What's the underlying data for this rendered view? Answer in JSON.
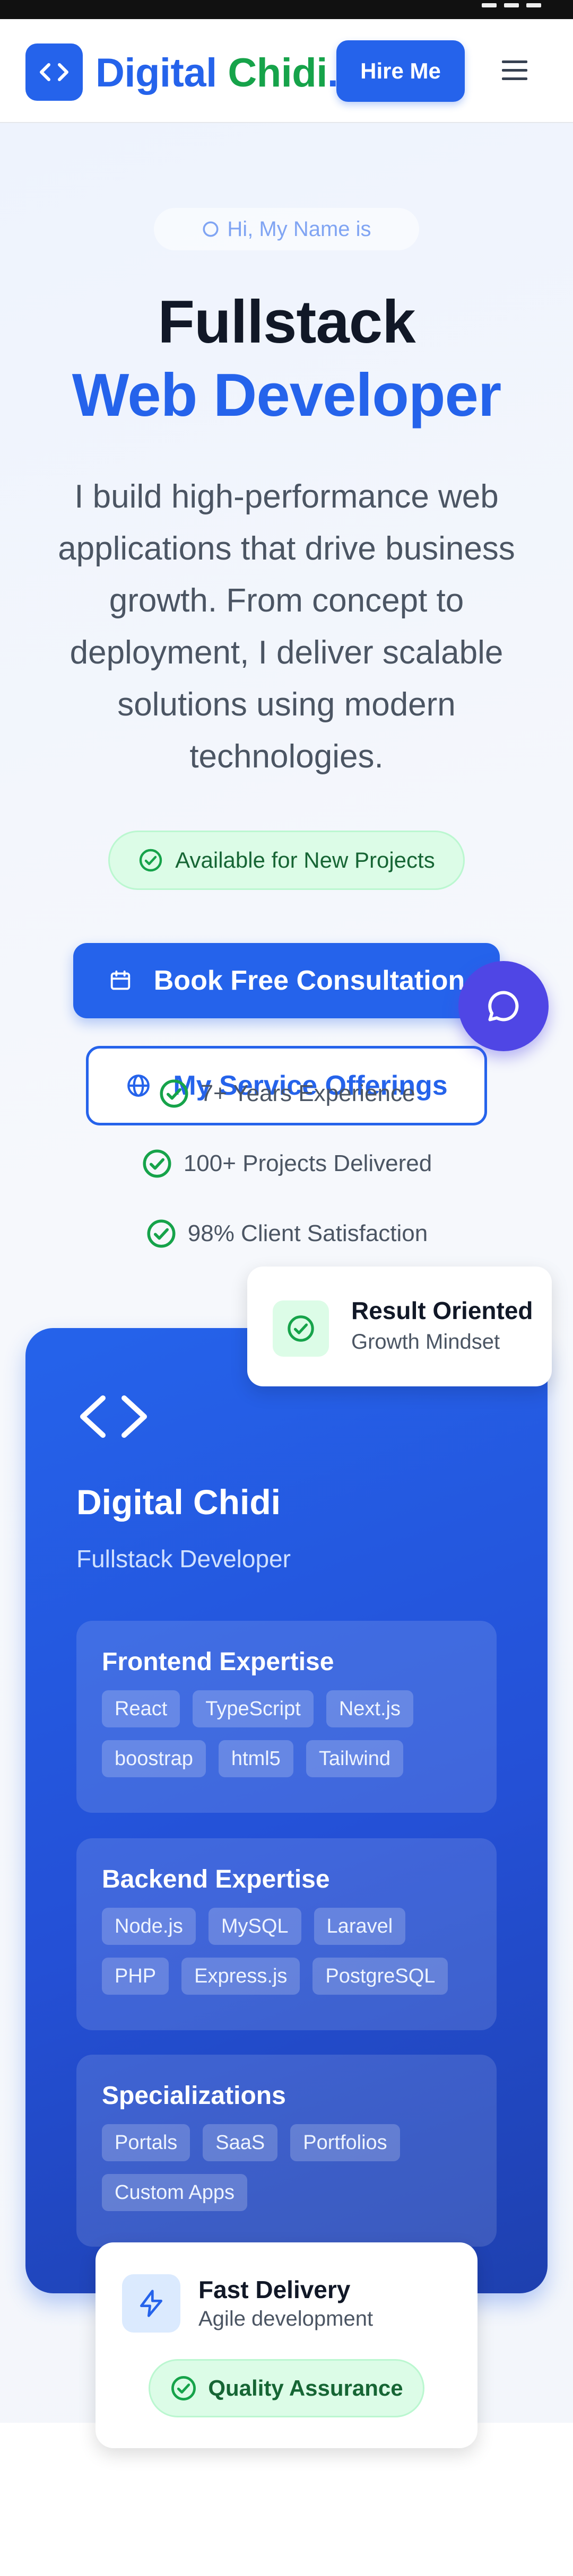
{
  "header": {
    "logo_word1": "Digital",
    "logo_word2": "Chidi",
    "logo_dot": ".",
    "hire_label": "Hire Me"
  },
  "hero": {
    "greeting": "Hi, My Name is",
    "title_line1": "Fullstack",
    "title_line2": "Web Developer",
    "intro": "I build high-performance web applications that drive business growth. From concept to deployment, I deliver scalable solutions using modern technologies.",
    "availability": "Available for New Projects",
    "primary_cta": "Book Free Consultation",
    "secondary_cta": "My Service Offerings",
    "highlights": [
      "7+ Years Experience",
      "100+ Projects Delivered",
      "98% Client Satisfaction"
    ]
  },
  "result_card": {
    "title": "Result Oriented",
    "subtitle": "Growth Mindset"
  },
  "profile": {
    "name": "Digital Chidi",
    "role": "Fullstack Developer",
    "groups": [
      {
        "title": "Frontend Expertise",
        "tags": [
          "React",
          "TypeScript",
          "Next.js",
          "boostrap",
          "html5",
          "Tailwind"
        ]
      },
      {
        "title": "Backend Expertise",
        "tags": [
          "Node.js",
          "MySQL",
          "Laravel",
          "PHP",
          "Express.js",
          "PostgreSQL"
        ]
      },
      {
        "title": "Specializations",
        "tags": [
          "Portals",
          "SaaS",
          "Portfolios",
          "Custom Apps"
        ]
      }
    ]
  },
  "fast_card": {
    "title": "Fast Delivery",
    "subtitle": "Agile development",
    "badge": "Quality Assurance"
  },
  "colors": {
    "primary": "#2563eb",
    "success": "#16a34a",
    "chat": "#4f46e5"
  },
  "icons": [
    "code-icon",
    "menu-icon",
    "check-circle-icon",
    "calendar-icon",
    "globe-icon",
    "chat-icon",
    "zap-icon"
  ]
}
